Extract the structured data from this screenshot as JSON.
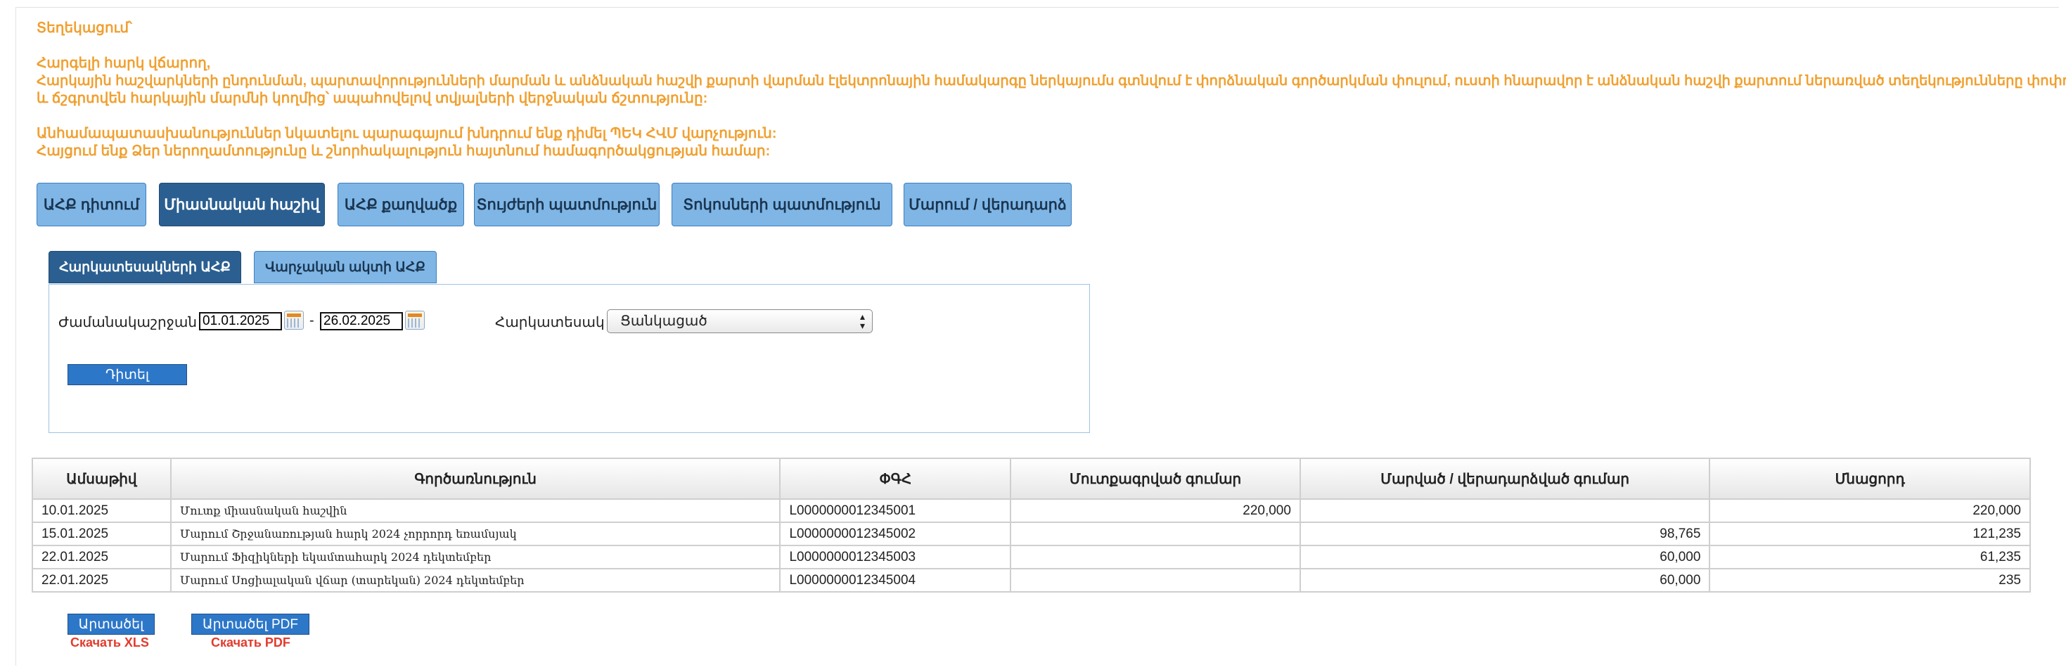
{
  "notice": {
    "title": "Տեղեկացում՝",
    "greeting": "Հարգելի հարկ վճարող,",
    "body_line1": "Հարկային հաշվարկների ընդունման, պարտավորությունների մարման և անձնական հաշվի քարտի վարման էլեկտրոնային համակարգը ներկայումս գտնվում է փորձնական գործարկման փուլում, ուստի հնարավոր է անձնական հաշվի քարտում ներառված տեղեկությունները փոփոխվեն",
    "body_line2": "և ճշգրտվեն հարկային մարմնի կողմից՝ ապահովելով տվյալների վերջնական ճշտությունը:",
    "contact_line1": "Անհամապատասխանություններ նկատելու պարագայում խնդրում ենք դիմել ՊԵԿ ՀՎՄ վարչություն:",
    "contact_line2": "Հայցում ենք Ձեր ներողամտությունը և շնորհակալություն հայտնում համագործակցության համար:"
  },
  "main_tabs": [
    {
      "label": "ԱՀՔ դիտում",
      "active": false
    },
    {
      "label": "Միասնական հաշիվ",
      "active": true
    },
    {
      "label": "ԱՀՔ քաղվածք",
      "active": false
    },
    {
      "label": "Տույժերի պատմություն",
      "active": false
    },
    {
      "label": "Տոկոսների պատմություն",
      "active": false
    },
    {
      "label": "Մարում / վերադարձ",
      "active": false
    }
  ],
  "sub_tabs": [
    {
      "label": "Հարկատեսակների ԱՀՔ",
      "active": true
    },
    {
      "label": "Վարչական ակտի ԱՀՔ",
      "active": false
    }
  ],
  "filter": {
    "period_label": "Ժամանակաշրջան",
    "date_from": "01.01.2025",
    "date_separator": "-",
    "date_to": "26.02.2025",
    "tax_type_label": "Հարկատեսակ",
    "tax_type_selected": "Ցանկացած",
    "view_button": "Դիտել"
  },
  "table": {
    "headers": [
      "Ամսաթիվ",
      "Գործառնություն",
      "ՓԳՀ",
      "Մուտքագրված գումար",
      "Մարված / վերադարձված գումար",
      "Մնացորդ"
    ],
    "rows": [
      [
        "10.01.2025",
        "Մուտք միասնական հաշվին",
        "L0000000012345001",
        "220,000",
        "",
        "220,000"
      ],
      [
        "15.01.2025",
        "Մարում Շրջանառության հարկ 2024 չորրորդ եռամսյակ",
        "L0000000012345002",
        "",
        "98,765",
        "121,235"
      ],
      [
        "22.01.2025",
        "Մարում Ֆիզիկների եկամտահարկ 2024 դեկտեմբեր",
        "L0000000012345003",
        "",
        "60,000",
        "61,235"
      ],
      [
        "22.01.2025",
        "Մարում Սոցիալական վճար (տարեկան) 2024 դեկտեմբեր",
        "L0000000012345004",
        "",
        "60,000",
        "235"
      ]
    ]
  },
  "export": {
    "xls_button": "Արտածել",
    "xls_sub": "Скачать XLS",
    "pdf_button": "Արտածել PDF",
    "pdf_sub": "Скачать PDF"
  },
  "colors": {
    "notice": "#f0a030",
    "tab": "#7fb6e6",
    "tab_active": "#2b5f91",
    "button": "#2d77c9",
    "export_sub": "#e23b2e"
  },
  "icons": [
    "calendar-icon",
    "select-arrow-icon"
  ]
}
